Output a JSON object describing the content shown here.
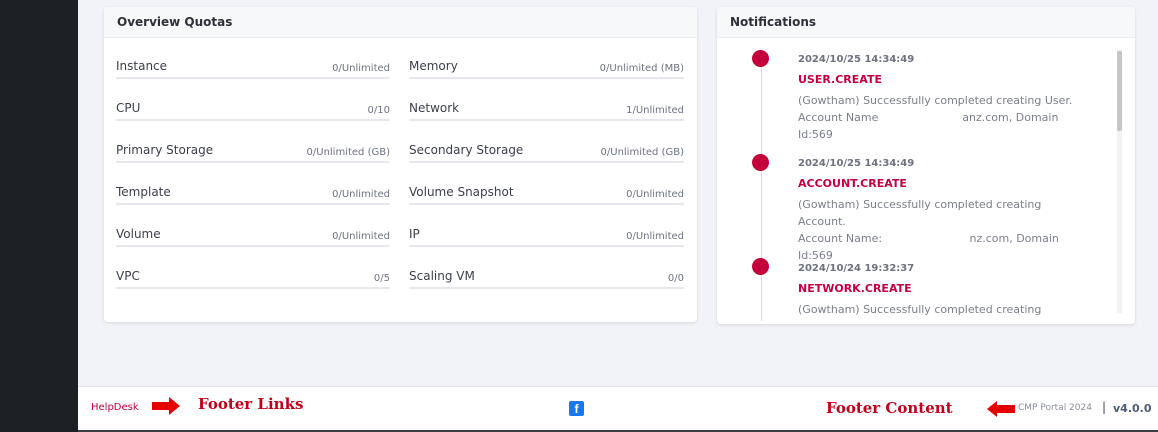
{
  "quotas": {
    "title": "Overview Quotas",
    "items": [
      {
        "label": "Instance",
        "value": "0/Unlimited"
      },
      {
        "label": "Memory",
        "value": "0/Unlimited (MB)"
      },
      {
        "label": "CPU",
        "value": "0/10"
      },
      {
        "label": "Network",
        "value": "1/Unlimited"
      },
      {
        "label": "Primary Storage",
        "value": "0/Unlimited (GB)"
      },
      {
        "label": "Secondary Storage",
        "value": "0/Unlimited (GB)"
      },
      {
        "label": "Template",
        "value": "0/Unlimited"
      },
      {
        "label": "Volume Snapshot",
        "value": "0/Unlimited"
      },
      {
        "label": "Volume",
        "value": "0/Unlimited"
      },
      {
        "label": "IP",
        "value": "0/Unlimited"
      },
      {
        "label": "VPC",
        "value": "0/5"
      },
      {
        "label": "Scaling VM",
        "value": "0/0"
      }
    ]
  },
  "notifications": {
    "title": "Notifications",
    "items": [
      {
        "time": "2024/10/25 14:34:49",
        "event": "USER.CREATE",
        "line1": "(Gowtham) Successfully completed creating User.",
        "line2": "Account Name                        anz.com, Domain",
        "line3": "Id:569"
      },
      {
        "time": "2024/10/25 14:34:49",
        "event": "ACCOUNT.CREATE",
        "line1": "(Gowtham) Successfully completed creating Account.",
        "line2": "Account Name:                         nz.com, Domain",
        "line3": "Id:569"
      },
      {
        "time": "2024/10/24 19:32:37",
        "event": "NETWORK.CREATE",
        "line1": "(Gowtham) Successfully completed creating network.",
        "line2": "",
        "line3": ""
      }
    ]
  },
  "footer": {
    "helpdesk": "HelpDesk",
    "annotation_links": "Footer Links",
    "annotation_content": "Footer Content",
    "facebook_glyph": "f",
    "copyright": "CMP Portal 2024",
    "separator": "|",
    "version": "v4.0.0"
  },
  "colors": {
    "accent": "#c2003a",
    "sidebar": "#1e2124"
  }
}
